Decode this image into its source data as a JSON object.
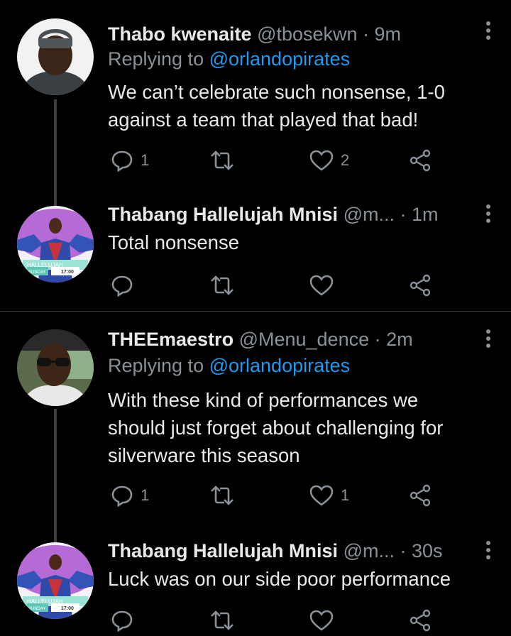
{
  "tweets": [
    {
      "name": "Thabo kwenaite",
      "meta": "@tbosekwn · 9m",
      "replying_prefix": "Replying to",
      "replying_handle": "@orlandopirates",
      "text_lines": [
        "We can’t celebrate such nonsense, 1-0",
        "against a team that played that bad!"
      ],
      "reply_count": "1",
      "like_count": "2"
    },
    {
      "name": "Thabang Hallelujah Mnisi",
      "meta": "@m... · 1m",
      "text_lines": [
        "Total nonsense"
      ],
      "reply_count": "",
      "like_count": ""
    },
    {
      "name": "THEEmaestro",
      "meta": "@Menu_dence · 2m",
      "replying_prefix": "Replying to",
      "replying_handle": "@orlandopirates",
      "text_lines": [
        "With these kind of performances we",
        "should just forget about challenging for",
        "silverware this season"
      ],
      "reply_count": "1",
      "like_count": "1"
    },
    {
      "name": "Thabang Hallelujah Mnisi",
      "meta": "@m... · 30s",
      "text_lines": [
        "Luck was on our side poor performance"
      ],
      "reply_count": "",
      "like_count": ""
    }
  ],
  "avatar_overlay": {
    "banner_text": "HALLELUJAH",
    "day": "SUNDAY",
    "time": "17:00"
  },
  "colors": {
    "background": "#000000",
    "text": "#e7e9ea",
    "muted": "#8b9198",
    "link": "#1d9bf0",
    "divider": "#2f3336"
  }
}
